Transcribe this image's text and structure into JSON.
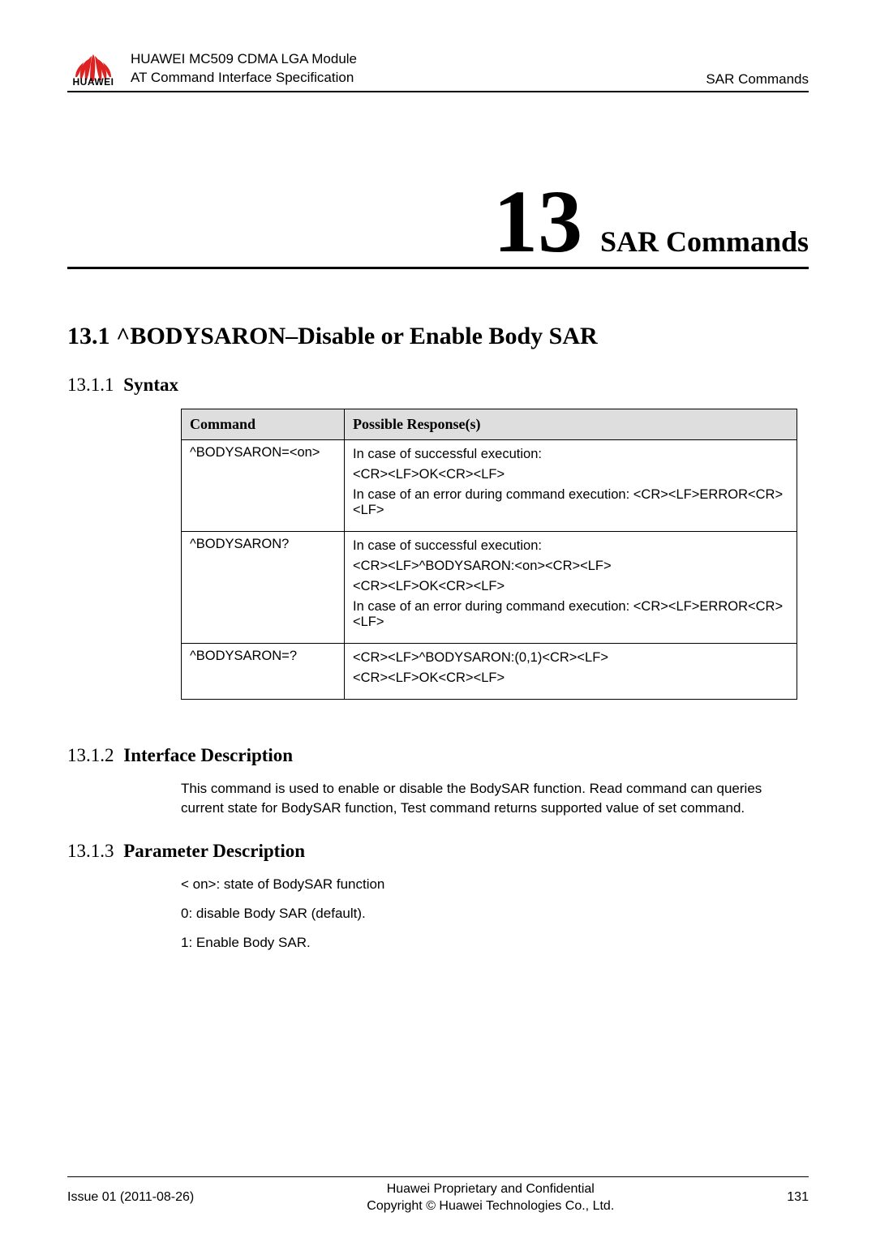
{
  "header": {
    "line1": "HUAWEI MC509 CDMA LGA Module",
    "line2": "AT Command Interface Specification",
    "right": "SAR Commands",
    "logo_word": "HUAWEI"
  },
  "chapter": {
    "number": "13",
    "title": "SAR  Commands"
  },
  "section": {
    "number": "13.1",
    "title": "^BODYSARON–Disable or Enable Body SAR"
  },
  "syntax": {
    "heading_num": "13.1.1",
    "heading_title": "Syntax",
    "col1": "Command",
    "col2": "Possible Response(s)",
    "rows": [
      {
        "cmd": "^BODYSARON=<on>",
        "resp": [
          "In case of successful execution:",
          "<CR><LF>OK<CR><LF>",
          "In case of an error during command execution: <CR><LF>ERROR<CR><LF>"
        ]
      },
      {
        "cmd": "^BODYSARON?",
        "resp": [
          "In case of successful execution:",
          "<CR><LF>^BODYSARON:<on><CR><LF>",
          "<CR><LF>OK<CR><LF>",
          "In case of an error during command execution: <CR><LF>ERROR<CR><LF>"
        ]
      },
      {
        "cmd": "^BODYSARON=?",
        "resp": [
          "<CR><LF>^BODYSARON:(0,1)<CR><LF>",
          "<CR><LF>OK<CR><LF>"
        ]
      }
    ]
  },
  "interface_desc": {
    "heading_num": "13.1.2",
    "heading_title": "Interface Description",
    "text": "This command is used to enable or disable the BodySAR function. Read command can queries current state for BodySAR function, Test command returns supported value of set command."
  },
  "param_desc": {
    "heading_num": "13.1.3",
    "heading_title": "Parameter Description",
    "lines": [
      "< on>: state of BodySAR function",
      "0: disable Body SAR (default).",
      "1: Enable Body SAR."
    ]
  },
  "footer": {
    "left": "Issue 01 (2011-08-26)",
    "mid1": "Huawei Proprietary and Confidential",
    "mid2": "Copyright © Huawei Technologies Co., Ltd.",
    "right": "131"
  }
}
